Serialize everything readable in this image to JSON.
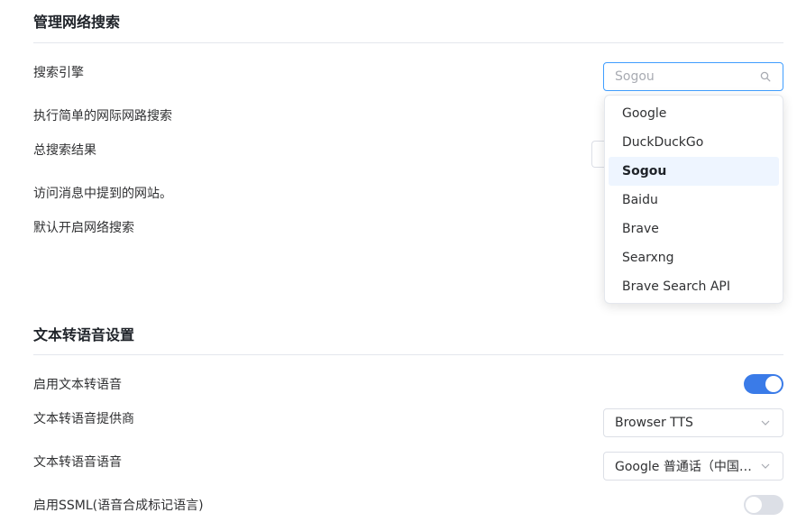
{
  "web_search": {
    "title": "管理网络搜索",
    "engine_label": "搜索引擎",
    "engine_select": {
      "placeholder": "Sogou",
      "icon": "search-icon"
    },
    "simple_search_label": "执行简单的网际网路搜索",
    "total_results_label": "总搜索结果",
    "visit_sites_label": "访问消息中提到的网站。",
    "default_enable_label": "默认开启网络搜索",
    "engine_options": [
      "Google",
      "DuckDuckGo",
      "Sogou",
      "Baidu",
      "Brave",
      "Searxng",
      "Brave Search API"
    ],
    "selected_engine": "Sogou"
  },
  "tts": {
    "title": "文本转语音设置",
    "enable_label": "启用文本转语音",
    "enable_on": true,
    "provider_label": "文本转语音提供商",
    "provider_value": "Browser TTS",
    "voice_label": "文本转语音语音",
    "voice_value": "Google 普通话（中国…",
    "ssml_label": "启用SSML(语音合成标记语言)",
    "ssml_on": false
  },
  "colors": {
    "accent": "#409eff",
    "toggle_on": "#3a7be8",
    "toggle_off": "#dcdfe6"
  }
}
